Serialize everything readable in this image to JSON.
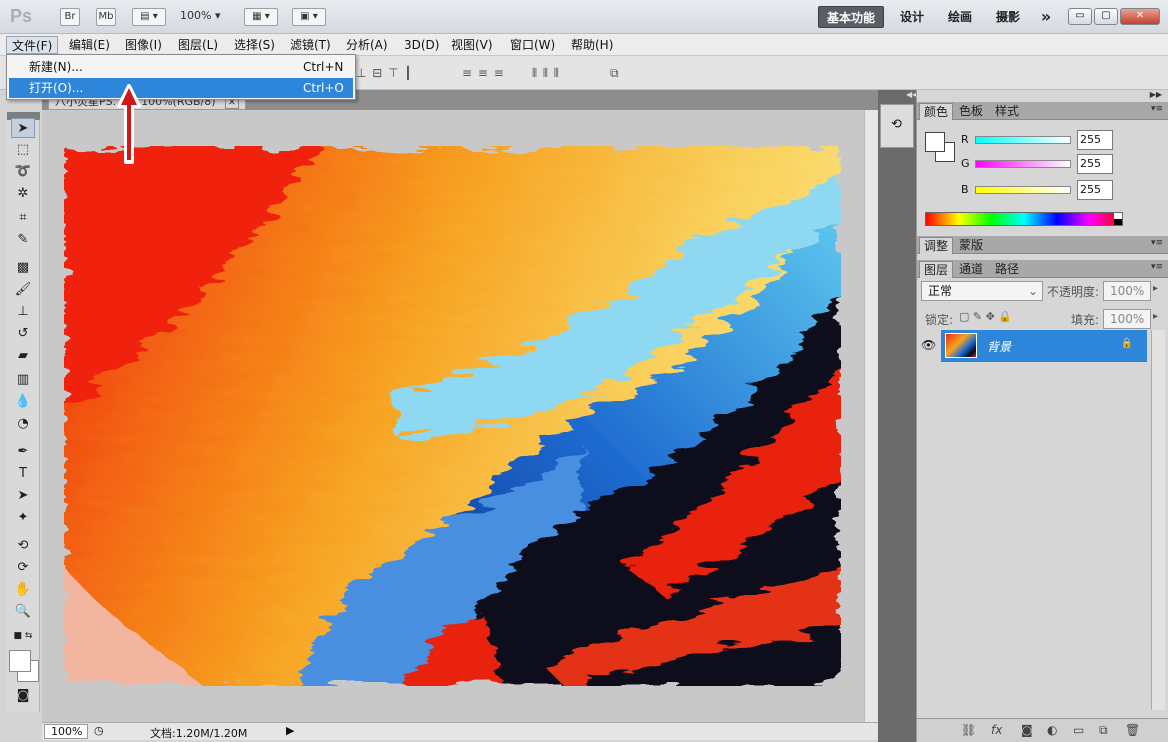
{
  "app": {
    "logo": "Ps",
    "bridge_btn": "Br",
    "minibridge_btn": "Mb",
    "zoom": "100%",
    "workspaces": [
      "基本功能",
      "设计",
      "绘画",
      "摄影"
    ],
    "more": "»"
  },
  "window_controls": {
    "minimize": "▭",
    "restore": "▢",
    "close": "✕"
  },
  "menu": [
    {
      "label": "文件(F)",
      "open": true
    },
    {
      "label": "编辑(E)"
    },
    {
      "label": "图像(I)"
    },
    {
      "label": "图层(L)"
    },
    {
      "label": "选择(S)"
    },
    {
      "label": "滤镜(T)"
    },
    {
      "label": "分析(A)"
    },
    {
      "label": "3D(D)"
    },
    {
      "label": "视图(V)"
    },
    {
      "label": "窗口(W)"
    },
    {
      "label": "帮助(H)"
    }
  ],
  "file_menu": [
    {
      "label": "新建(N)...",
      "shortcut": "Ctrl+N",
      "highlighted": false
    },
    {
      "label": "打开(O)...",
      "shortcut": "Ctrl+O",
      "highlighted": true
    }
  ],
  "document": {
    "tab_title": "八小灵星PS... @ 100%(RGB/8)",
    "tab_close": "✕",
    "status_zoom": "100%",
    "doc_info": "文档:1.20M/1.20M"
  },
  "panels": {
    "color_tabs": [
      "颜色",
      "色板",
      "样式"
    ],
    "rgb": [
      {
        "channel": "R",
        "value": "255",
        "color_from": "#00ffff",
        "color_to": "#ffffff"
      },
      {
        "channel": "G",
        "value": "255",
        "color_from": "#ff00ff",
        "color_to": "#ffffff"
      },
      {
        "channel": "B",
        "value": "255",
        "color_from": "#ffff00",
        "color_to": "#ffffff"
      }
    ],
    "adjust_tabs": [
      "调整",
      "蒙版"
    ],
    "layer_tabs": [
      "图层",
      "通道",
      "路径"
    ],
    "blend_mode": "正常",
    "opacity_label": "不透明度:",
    "opacity": "100%",
    "lock_label": "锁定:",
    "fill_label": "填充:",
    "fill": "100%",
    "layer": {
      "name": "背景",
      "visible": true,
      "locked": true
    }
  },
  "colors": {
    "accent": "#2d86d9",
    "arrow": "#d01818"
  }
}
